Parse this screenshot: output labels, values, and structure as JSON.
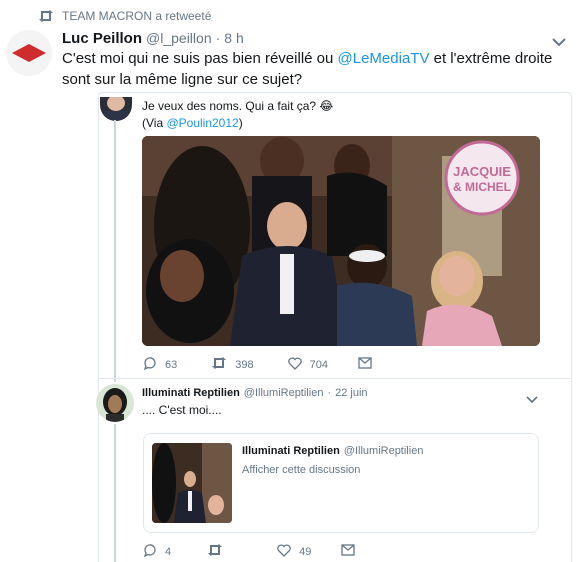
{
  "retweet_banner": {
    "text": "TEAM MACRON a retweeté"
  },
  "main_tweet": {
    "display_name": "Luc Peillon",
    "handle": "@l_peillon",
    "separator": "·",
    "time": "8 h",
    "text_part1": "C'est moi qui ne suis pas bien réveillé ou ",
    "mention": "@LeMediaTV",
    "text_part2": " et l'extrême droite sont sur la même ligne sur ce sujet?"
  },
  "embedded_tweet": {
    "text": "Je veux des noms. Qui a fait ça? 😂",
    "via_prefix": "(Via ",
    "via_mention": "@Poulin2012",
    "via_suffix": ")",
    "watermark": "JACQUIE & MICHEL",
    "actions": {
      "replies": "63",
      "retweets": "398",
      "likes": "704"
    }
  },
  "reply_tweet": {
    "display_name": "Illuminati Reptilien",
    "handle": "@IllumiReptilien",
    "separator": "·",
    "date": "22 juin",
    "text": ".... C'est moi....",
    "quoted": {
      "display_name": "Illuminati Reptilien",
      "handle": "@IllumiReptilien",
      "text": "Afficher cette discussion"
    },
    "actions": {
      "replies": "4",
      "retweets": "",
      "likes": "49"
    }
  },
  "colors": {
    "link": "#1b95e0",
    "muted": "#657786",
    "border": "#e1e8ed",
    "avatar_red": "#cf2d2d"
  },
  "icons": [
    "retweet-icon",
    "chevron-down-icon",
    "reply-icon",
    "like-icon",
    "message-icon"
  ]
}
